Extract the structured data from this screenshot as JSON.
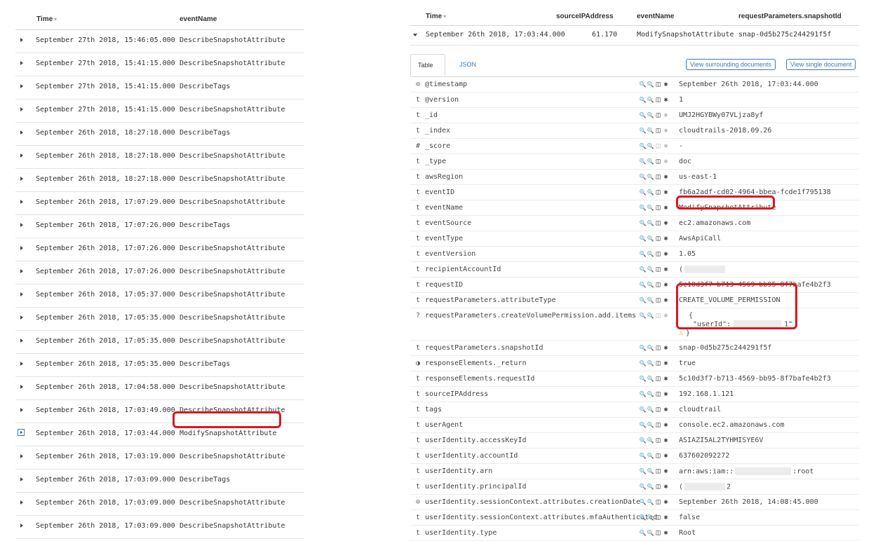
{
  "left_table": {
    "col_time": "Time",
    "col_event": "eventName",
    "rows": [
      {
        "time": "September 27th 2018, 15:46:05.000",
        "event": "DescribeSnapshotAttribute"
      },
      {
        "time": "September 27th 2018, 15:41:15.000",
        "event": "DescribeSnapshotAttribute"
      },
      {
        "time": "September 27th 2018, 15:41:15.000",
        "event": "DescribeTags"
      },
      {
        "time": "September 27th 2018, 15:41:15.000",
        "event": "DescribeSnapshotAttribute"
      },
      {
        "time": "September 26th 2018, 18:27:18.000",
        "event": "DescribeTags"
      },
      {
        "time": "September 26th 2018, 18:27:18.000",
        "event": "DescribeSnapshotAttribute"
      },
      {
        "time": "September 26th 2018, 18:27:18.000",
        "event": "DescribeSnapshotAttribute"
      },
      {
        "time": "September 26th 2018, 17:07:29.000",
        "event": "DescribeSnapshotAttribute"
      },
      {
        "time": "September 26th 2018, 17:07:26.000",
        "event": "DescribeTags"
      },
      {
        "time": "September 26th 2018, 17:07:26.000",
        "event": "DescribeSnapshotAttribute"
      },
      {
        "time": "September 26th 2018, 17:07:26.000",
        "event": "DescribeSnapshotAttribute"
      },
      {
        "time": "September 26th 2018, 17:05:37.000",
        "event": "DescribeSnapshotAttribute"
      },
      {
        "time": "September 26th 2018, 17:05:35.000",
        "event": "DescribeSnapshotAttribute"
      },
      {
        "time": "September 26th 2018, 17:05:35.000",
        "event": "DescribeSnapshotAttribute"
      },
      {
        "time": "September 26th 2018, 17:05:35.000",
        "event": "DescribeTags"
      },
      {
        "time": "September 26th 2018, 17:04:58.000",
        "event": "DescribeSnapshotAttribute"
      },
      {
        "time": "September 26th 2018, 17:03:49.000",
        "event": "DescribeSnapshotAttribute"
      },
      {
        "time": "September 26th 2018, 17:03:44.000",
        "event": "ModifySnapshotAttribute"
      },
      {
        "time": "September 26th 2018, 17:03:19.000",
        "event": "DescribeSnapshotAttribute"
      },
      {
        "time": "September 26th 2018, 17:03:09.000",
        "event": "DescribeTags"
      },
      {
        "time": "September 26th 2018, 17:03:09.000",
        "event": "DescribeSnapshotAttribute"
      },
      {
        "time": "September 26th 2018, 17:03:09.000",
        "event": "DescribeSnapshotAttribute"
      }
    ]
  },
  "right_table": {
    "col_time": "Time",
    "col_ip": "sourceIPAddress",
    "col_event": "eventName",
    "col_snapshot": "requestParameters.snapshotId",
    "doc": {
      "time": "September 26th 2018, 17:03:44.000",
      "ip": "61.170",
      "event": "ModifySnapshotAttribute",
      "snapshot": "snap-0d5b275c244291f5f"
    },
    "tabs": {
      "table": "Table",
      "json": "JSON"
    },
    "buttons": {
      "surrounding": "View surrounding documents",
      "single": "View single document"
    },
    "fields": [
      {
        "type": "clock",
        "name": "@timestamp",
        "value": "September 26th 2018, 17:03:44.000"
      },
      {
        "type": "t",
        "name": "@version",
        "value": "1"
      },
      {
        "type": "t",
        "name": "_id",
        "value": "UMJ2HGYBWy07VLjza8yf",
        "dimstar": true
      },
      {
        "type": "t",
        "name": "_index",
        "value": "cloudtrails-2018.09.26",
        "dimstar": true
      },
      {
        "type": "#",
        "name": "_score",
        "value": "-",
        "disabled": true
      },
      {
        "type": "t",
        "name": "_type",
        "value": "doc",
        "dimstar": true
      },
      {
        "type": "t",
        "name": "awsRegion",
        "value": "us-east-1"
      },
      {
        "type": "t",
        "name": "eventID",
        "value": "fb6a2adf-cd02-4964-bbea-fcde1f795138"
      },
      {
        "type": "t",
        "name": "eventName",
        "value": "ModifySnapshotAttribute"
      },
      {
        "type": "t",
        "name": "eventSource",
        "value": "ec2.amazonaws.com"
      },
      {
        "type": "t",
        "name": "eventType",
        "value": "AwsApiCall"
      },
      {
        "type": "t",
        "name": "eventVersion",
        "value": "1.05"
      },
      {
        "type": "t",
        "name": "recipientAccountId",
        "value": "("
      },
      {
        "type": "t",
        "name": "requestID",
        "value": "5c10d3f7-b713-4569-bb95-8f7bafe4b2f3"
      },
      {
        "type": "t",
        "name": "requestParameters.attributeType",
        "value": "CREATE_VOLUME_PERMISSION"
      },
      {
        "type": "?",
        "name": "requestParameters.createVolumePermission.add.items",
        "value_open": "{",
        "value_key": "\"userId\":",
        "value_end": "1\"",
        "value_close": "}",
        "warn": "⚠",
        "disabled": true
      },
      {
        "type": "t",
        "name": "requestParameters.snapshotId",
        "value": "snap-0d5b275c244291f5f"
      },
      {
        "type": "bool",
        "name": "responseElements._return",
        "value": "true"
      },
      {
        "type": "t",
        "name": "responseElements.requestId",
        "value": "5c10d3f7-b713-4569-bb95-8f7bafe4b2f3"
      },
      {
        "type": "t",
        "name": "sourceIPAddress",
        "value": "192.168.1.121"
      },
      {
        "type": "t",
        "name": "tags",
        "value": "cloudtrail"
      },
      {
        "type": "t",
        "name": "userAgent",
        "value": "console.ec2.amazonaws.com"
      },
      {
        "type": "t",
        "name": "userIdentity.accessKeyId",
        "value": "ASIAZI5AL2TYHMISYE6V"
      },
      {
        "type": "t",
        "name": "userIdentity.accountId",
        "value": "637602092272"
      },
      {
        "type": "t",
        "name": "userIdentity.arn",
        "value": "arn:aws:iam::",
        "value_suffix": ":root"
      },
      {
        "type": "t",
        "name": "userIdentity.principalId",
        "value": "(",
        "value_suffix": "2"
      },
      {
        "type": "clock",
        "name": "userIdentity.sessionContext.attributes.creationDate",
        "value": "September 26th 2018, 14:08:45.000"
      },
      {
        "type": "t",
        "name": "userIdentity.sessionContext.attributes.mfaAuthenticated",
        "value": "false"
      },
      {
        "type": "t",
        "name": "userIdentity.type",
        "value": "Root"
      }
    ]
  },
  "icons": {
    "zoom_in": "🔍",
    "zoom_out": "🔍",
    "toggle_column": "◫",
    "filter_exists": "✱",
    "clock": "⊙",
    "bool": "◑"
  },
  "colors": {
    "highlight": "#d8181e",
    "link": "#3a7ab5"
  }
}
